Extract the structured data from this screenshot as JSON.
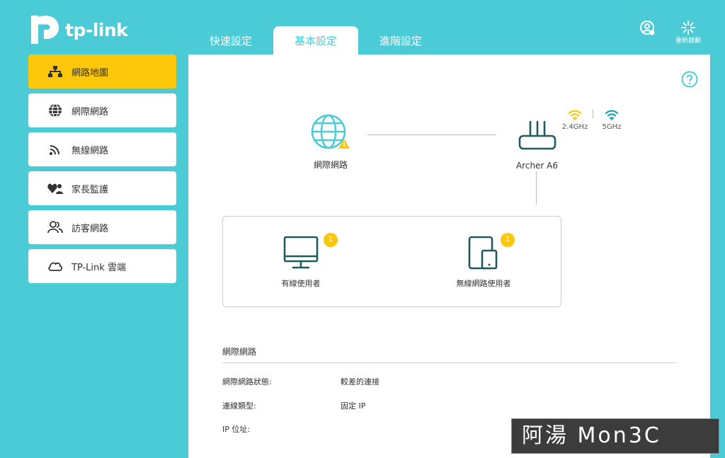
{
  "brand": {
    "name": "tp-link",
    "color": "#4acbd6",
    "accent": "#fdc80b"
  },
  "header": {
    "tabs": [
      {
        "label": "快速設定"
      },
      {
        "label": "基本設定",
        "active": true
      },
      {
        "label": "進階設定"
      }
    ],
    "reboot_label": "重新啟動",
    "login_icon": "user-circle-icon"
  },
  "sidebar": {
    "items": [
      {
        "label": "網路地圖",
        "icon": "network-map-icon",
        "active": true
      },
      {
        "label": "網際網路",
        "icon": "globe-icon"
      },
      {
        "label": "無線網路",
        "icon": "wifi-signal-icon"
      },
      {
        "label": "家長監護",
        "icon": "family-icon"
      },
      {
        "label": "訪客網路",
        "icon": "guests-icon"
      },
      {
        "label": "TP-Link 雲端",
        "icon": "cloud-icon"
      }
    ]
  },
  "network_map": {
    "internet_label": "網際網路",
    "router_label": "Archer A6",
    "bands": [
      {
        "label": "2.4GHz",
        "color": "#fdc80b"
      },
      {
        "label": "5GHz",
        "color": "#4acbd6"
      }
    ],
    "clients": [
      {
        "label": "有線使用者",
        "count": "1",
        "icon": "monitor-icon"
      },
      {
        "label": "無線網路使用者",
        "count": "1",
        "icon": "tablet-icon"
      }
    ]
  },
  "internet_section": {
    "title": "網際網路",
    "rows": [
      {
        "label": "網際網路狀態:",
        "value": "較差的連接"
      },
      {
        "label": "連線類型:",
        "value": "固定 IP"
      },
      {
        "label": "IP 位址:",
        "value": ""
      }
    ]
  },
  "watermark": {
    "text": "阿湯 Mon3C"
  }
}
